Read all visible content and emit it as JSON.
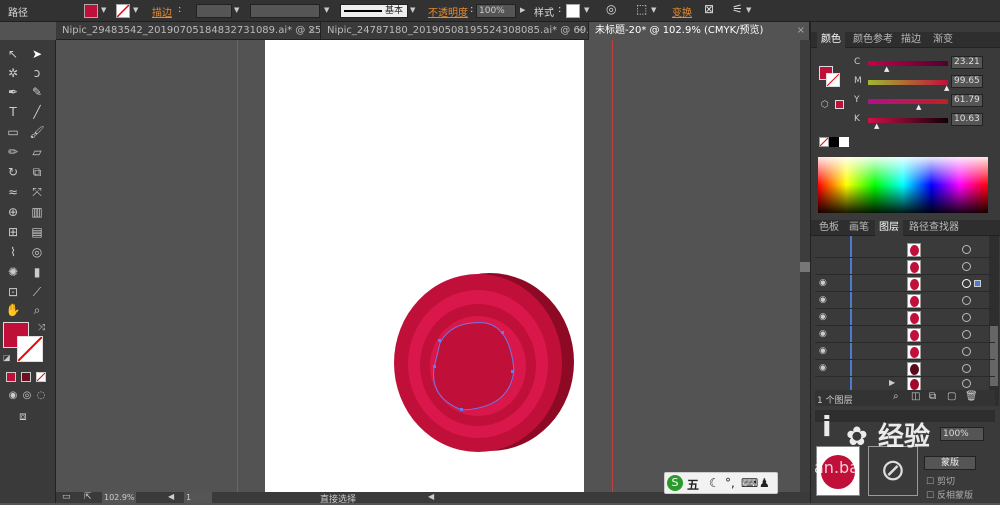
{
  "topbar": {
    "object_type": "路径",
    "stroke_label": "描边",
    "stroke_profile": "基本",
    "opacity_label": "不透明度",
    "opacity_value": "100%",
    "style_label": "样式",
    "transform_label": "变换",
    "fill_color": "#c0103a"
  },
  "tabs": [
    {
      "label": "Nipic_29483542_20190705184832731089.ai* @ 25..."
    },
    {
      "label": "Nipic_24787180_20190508195524308085.ai* @ 69..."
    },
    {
      "label": "未标题-20* @ 102.9% (CMYK/预览)"
    }
  ],
  "color_panel": {
    "tabs": [
      "颜色",
      "颜色参考",
      "描边",
      "渐变"
    ],
    "sliders": [
      {
        "letter": "C",
        "value": "23.21"
      },
      {
        "letter": "M",
        "value": "99.65"
      },
      {
        "letter": "Y",
        "value": "61.79"
      },
      {
        "letter": "K",
        "value": "10.63"
      }
    ]
  },
  "layers_panel": {
    "tabs": [
      "色板",
      "画笔",
      "图层",
      "路径查找器"
    ],
    "footer_count": "1 个图层"
  },
  "transparency_panel": {
    "opacity": "100%",
    "mask_button": "蒙版",
    "clip_label": "剪切",
    "invert_label": "反相蒙版"
  },
  "status": {
    "zoom": "102.9%",
    "page": "1",
    "tool": "直接选择"
  },
  "ime": {
    "label": "五"
  },
  "watermark": {
    "text": "经验",
    "domain": "an.ba"
  }
}
